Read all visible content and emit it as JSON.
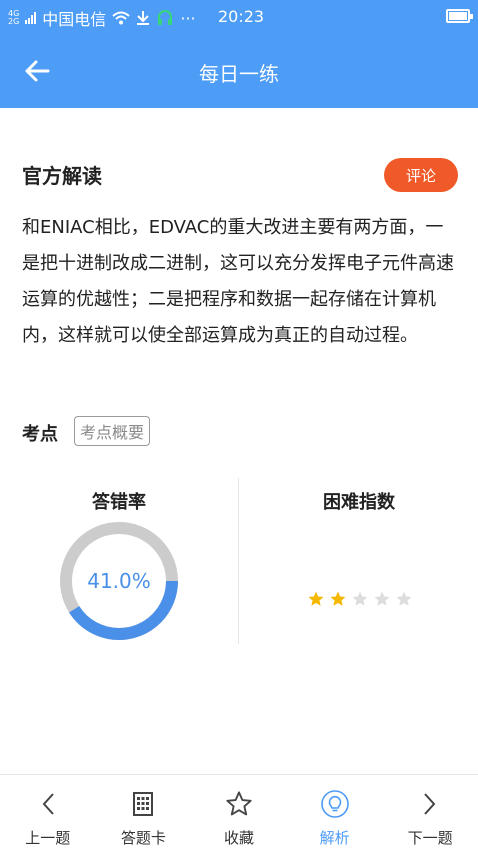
{
  "status_bar": {
    "network_top": "4G",
    "network_bottom": "2G",
    "carrier": "中国电信",
    "more": "···",
    "time": "20:23"
  },
  "app_bar": {
    "title": "每日一练",
    "back_icon": "arrow-left-icon"
  },
  "explanation": {
    "heading": "官方解读",
    "comment_label": "评论",
    "text": "和ENIAC相比，EDVAC的重大改进主要有两方面，一是把十进制改成二进制，这可以充分发挥电子元件高速运算的优越性；二是把程序和数据一起存储在计算机内，这样就可以使全部运算成为真正的自动过程。"
  },
  "kaodian": {
    "label": "考点",
    "tag": "考点概要"
  },
  "stats": {
    "error_rate_title": "答错率",
    "error_rate_text": "41.0%",
    "error_rate_fraction": 0.41,
    "difficulty_title": "困难指数",
    "difficulty_stars": 2,
    "difficulty_max": 5
  },
  "colors": {
    "primary": "#4d9cf5",
    "accent_orange": "#f05a28",
    "ring_track": "#cccccc",
    "ring_fill": "#4a90e8",
    "star_on": "#f5b800",
    "star_off": "#dddddd"
  },
  "bottom_nav": {
    "items": [
      {
        "label": "上一题",
        "icon": "chevron-left-icon"
      },
      {
        "label": "答题卡",
        "icon": "answer-card-icon"
      },
      {
        "label": "收藏",
        "icon": "star-outline-icon"
      },
      {
        "label": "解析",
        "icon": "lightbulb-icon",
        "active": true
      },
      {
        "label": "下一题",
        "icon": "chevron-right-icon"
      }
    ]
  }
}
